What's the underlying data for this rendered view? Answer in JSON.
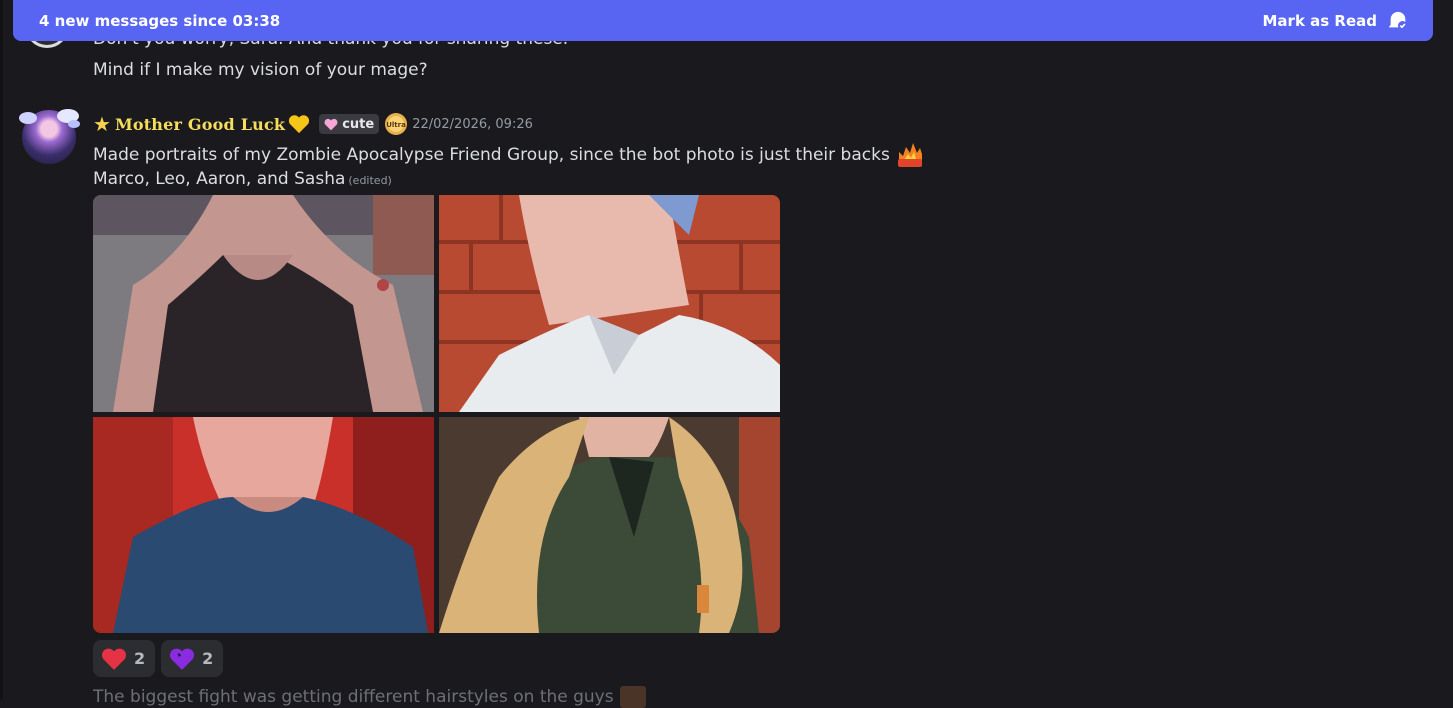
{
  "new_messages_bar": {
    "text": "4 new messages since 03:38",
    "mark_read_label": "Mark as Read",
    "icon": "mark-read-icon",
    "color": "#5865f2"
  },
  "previous_message": {
    "line1": "Don't you worry, Sara. And thank you for sharing these.",
    "line2": "Mind if I make my vision of your mage?"
  },
  "message": {
    "username": "Mother Good Luck",
    "username_color": "#f6dd5a",
    "tag": "cute",
    "badge": "Ultra",
    "timestamp": "22/02/2026, 09:26",
    "line1": "Made portraits of my Zombie Apocalypse Friend Group, since the bot photo is just their backs",
    "line2": "Marco, Leo, Aaron, and Sasha",
    "edited": "(edited)",
    "images": [
      {
        "alt": "Marco portrait"
      },
      {
        "alt": "Leo portrait"
      },
      {
        "alt": "Aaron portrait"
      },
      {
        "alt": "Sasha portrait"
      }
    ],
    "reactions": [
      {
        "emoji": "red-heart-icon",
        "count": "2"
      },
      {
        "emoji": "purple-heart-icon",
        "count": "2"
      }
    ]
  },
  "next_message": {
    "line": "The biggest fight was getting different hairstyles on the guys"
  }
}
